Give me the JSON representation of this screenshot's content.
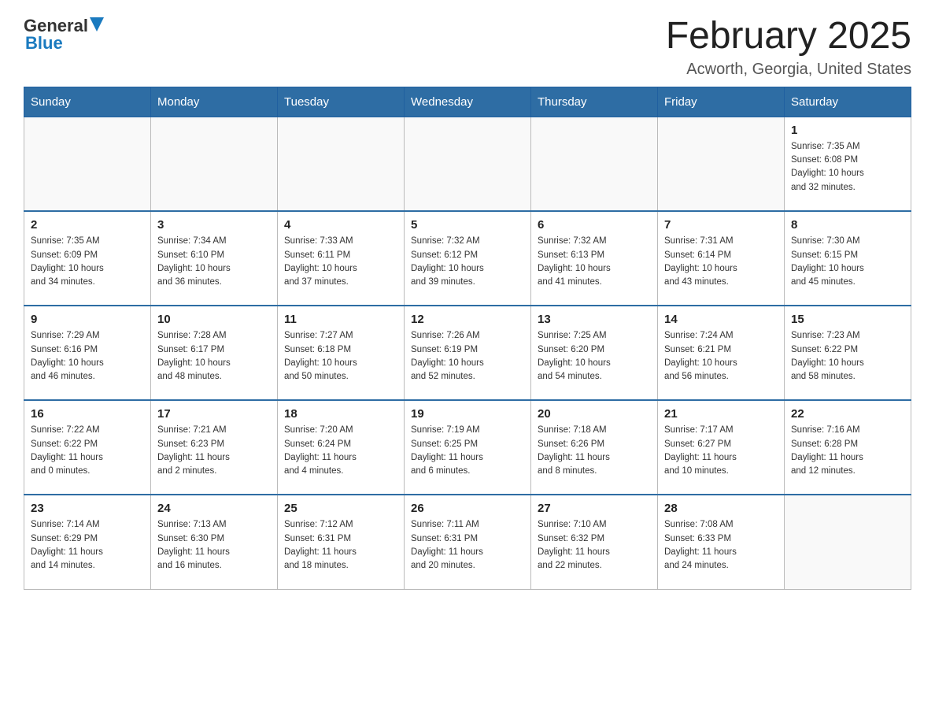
{
  "header": {
    "logo_general": "General",
    "logo_blue": "Blue",
    "month_title": "February 2025",
    "location": "Acworth, Georgia, United States"
  },
  "weekdays": [
    "Sunday",
    "Monday",
    "Tuesday",
    "Wednesday",
    "Thursday",
    "Friday",
    "Saturday"
  ],
  "weeks": [
    [
      {
        "day": "",
        "info": ""
      },
      {
        "day": "",
        "info": ""
      },
      {
        "day": "",
        "info": ""
      },
      {
        "day": "",
        "info": ""
      },
      {
        "day": "",
        "info": ""
      },
      {
        "day": "",
        "info": ""
      },
      {
        "day": "1",
        "info": "Sunrise: 7:35 AM\nSunset: 6:08 PM\nDaylight: 10 hours\nand 32 minutes."
      }
    ],
    [
      {
        "day": "2",
        "info": "Sunrise: 7:35 AM\nSunset: 6:09 PM\nDaylight: 10 hours\nand 34 minutes."
      },
      {
        "day": "3",
        "info": "Sunrise: 7:34 AM\nSunset: 6:10 PM\nDaylight: 10 hours\nand 36 minutes."
      },
      {
        "day": "4",
        "info": "Sunrise: 7:33 AM\nSunset: 6:11 PM\nDaylight: 10 hours\nand 37 minutes."
      },
      {
        "day": "5",
        "info": "Sunrise: 7:32 AM\nSunset: 6:12 PM\nDaylight: 10 hours\nand 39 minutes."
      },
      {
        "day": "6",
        "info": "Sunrise: 7:32 AM\nSunset: 6:13 PM\nDaylight: 10 hours\nand 41 minutes."
      },
      {
        "day": "7",
        "info": "Sunrise: 7:31 AM\nSunset: 6:14 PM\nDaylight: 10 hours\nand 43 minutes."
      },
      {
        "day": "8",
        "info": "Sunrise: 7:30 AM\nSunset: 6:15 PM\nDaylight: 10 hours\nand 45 minutes."
      }
    ],
    [
      {
        "day": "9",
        "info": "Sunrise: 7:29 AM\nSunset: 6:16 PM\nDaylight: 10 hours\nand 46 minutes."
      },
      {
        "day": "10",
        "info": "Sunrise: 7:28 AM\nSunset: 6:17 PM\nDaylight: 10 hours\nand 48 minutes."
      },
      {
        "day": "11",
        "info": "Sunrise: 7:27 AM\nSunset: 6:18 PM\nDaylight: 10 hours\nand 50 minutes."
      },
      {
        "day": "12",
        "info": "Sunrise: 7:26 AM\nSunset: 6:19 PM\nDaylight: 10 hours\nand 52 minutes."
      },
      {
        "day": "13",
        "info": "Sunrise: 7:25 AM\nSunset: 6:20 PM\nDaylight: 10 hours\nand 54 minutes."
      },
      {
        "day": "14",
        "info": "Sunrise: 7:24 AM\nSunset: 6:21 PM\nDaylight: 10 hours\nand 56 minutes."
      },
      {
        "day": "15",
        "info": "Sunrise: 7:23 AM\nSunset: 6:22 PM\nDaylight: 10 hours\nand 58 minutes."
      }
    ],
    [
      {
        "day": "16",
        "info": "Sunrise: 7:22 AM\nSunset: 6:22 PM\nDaylight: 11 hours\nand 0 minutes."
      },
      {
        "day": "17",
        "info": "Sunrise: 7:21 AM\nSunset: 6:23 PM\nDaylight: 11 hours\nand 2 minutes."
      },
      {
        "day": "18",
        "info": "Sunrise: 7:20 AM\nSunset: 6:24 PM\nDaylight: 11 hours\nand 4 minutes."
      },
      {
        "day": "19",
        "info": "Sunrise: 7:19 AM\nSunset: 6:25 PM\nDaylight: 11 hours\nand 6 minutes."
      },
      {
        "day": "20",
        "info": "Sunrise: 7:18 AM\nSunset: 6:26 PM\nDaylight: 11 hours\nand 8 minutes."
      },
      {
        "day": "21",
        "info": "Sunrise: 7:17 AM\nSunset: 6:27 PM\nDaylight: 11 hours\nand 10 minutes."
      },
      {
        "day": "22",
        "info": "Sunrise: 7:16 AM\nSunset: 6:28 PM\nDaylight: 11 hours\nand 12 minutes."
      }
    ],
    [
      {
        "day": "23",
        "info": "Sunrise: 7:14 AM\nSunset: 6:29 PM\nDaylight: 11 hours\nand 14 minutes."
      },
      {
        "day": "24",
        "info": "Sunrise: 7:13 AM\nSunset: 6:30 PM\nDaylight: 11 hours\nand 16 minutes."
      },
      {
        "day": "25",
        "info": "Sunrise: 7:12 AM\nSunset: 6:31 PM\nDaylight: 11 hours\nand 18 minutes."
      },
      {
        "day": "26",
        "info": "Sunrise: 7:11 AM\nSunset: 6:31 PM\nDaylight: 11 hours\nand 20 minutes."
      },
      {
        "day": "27",
        "info": "Sunrise: 7:10 AM\nSunset: 6:32 PM\nDaylight: 11 hours\nand 22 minutes."
      },
      {
        "day": "28",
        "info": "Sunrise: 7:08 AM\nSunset: 6:33 PM\nDaylight: 11 hours\nand 24 minutes."
      },
      {
        "day": "",
        "info": ""
      }
    ]
  ]
}
